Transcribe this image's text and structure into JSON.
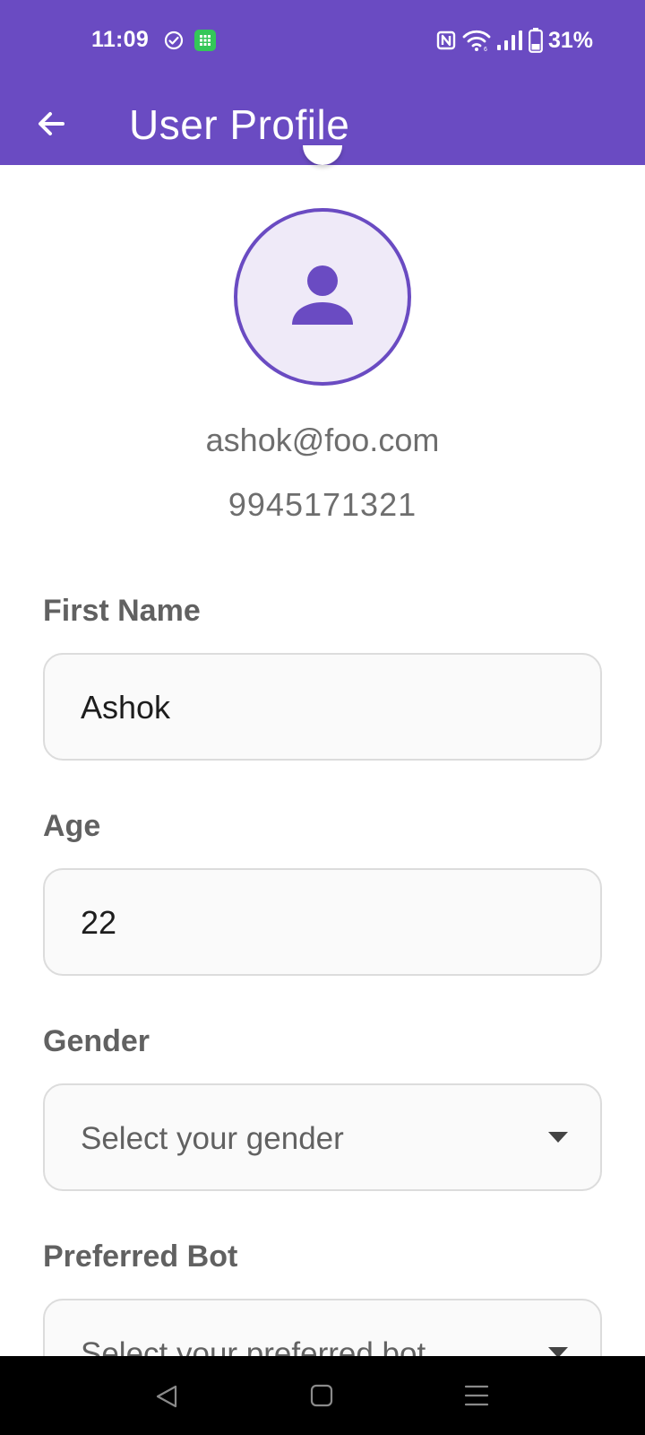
{
  "status_bar": {
    "time": "11:09",
    "battery": "31%"
  },
  "app_bar": {
    "title": "User Profile",
    "back_icon": "arrow-left-icon"
  },
  "profile": {
    "email": "ashok@foo.com",
    "phone": "9945171321",
    "avatar_icon": "person-icon"
  },
  "form": {
    "first_name": {
      "label": "First Name",
      "value": "Ashok"
    },
    "age": {
      "label": "Age",
      "value": "22"
    },
    "gender": {
      "label": "Gender",
      "placeholder": "Select your gender"
    },
    "preferred_bot": {
      "label": "Preferred Bot",
      "placeholder": "Select your preferred bot"
    }
  },
  "colors": {
    "primary": "#6a4bc2",
    "avatar_bg": "#efeaf8",
    "field_bg": "#fafafa",
    "field_border": "#dcdcdc"
  }
}
